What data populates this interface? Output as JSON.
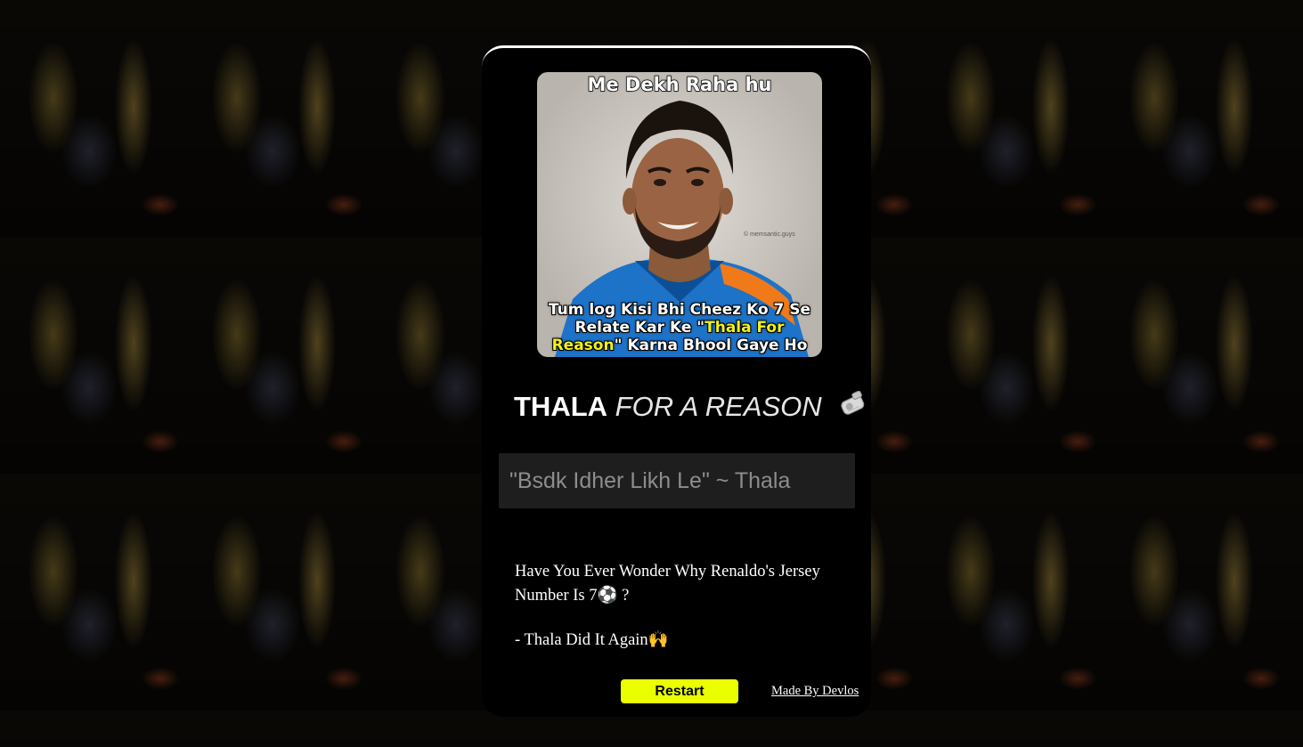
{
  "meme": {
    "top_caption": "Me Dekh Raha hu",
    "bottom_caption_line1": "Tum log Kisi Bhi Cheez Ko 7 Se",
    "bottom_caption_line2_a": "Relate Kar Ke \"",
    "bottom_caption_line2_hl": "Thala For",
    "bottom_caption_line3_hl": "Reason",
    "bottom_caption_line3_b": "\" Karna Bhool Gaye Ho",
    "watermark": "© memsantic.guys"
  },
  "title": {
    "bold": "THALA",
    "light": "FOR A REASON",
    "icon": "whistle-icon"
  },
  "input": {
    "placeholder": "\"Bsdk Idher Likh Le\" ~ Thala",
    "value": ""
  },
  "message": {
    "line1": "Have You Ever Wonder Why Renaldo's Jersey Number Is 7⚽ ?",
    "line2": "- Thala Did It Again🙌"
  },
  "actions": {
    "restart_label": "Restart"
  },
  "footer": {
    "credit": "Made By Devlos"
  },
  "colors": {
    "card_bg": "#000000",
    "button_accent": "#eaff00",
    "highlight_text": "#f1f21a"
  }
}
